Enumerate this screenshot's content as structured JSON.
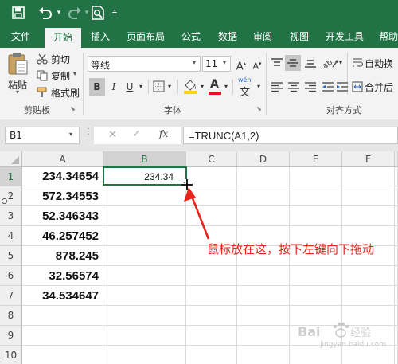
{
  "quick_access": {
    "save_icon": "save-icon",
    "undo_icon": "undo-icon",
    "redo_icon": "redo-icon",
    "print_preview_icon": "print-preview-icon",
    "customize_icon": "customize-icon"
  },
  "tabs": [
    "文件",
    "开始",
    "插入",
    "页面布局",
    "公式",
    "数据",
    "审阅",
    "视图",
    "开发工具",
    "帮助"
  ],
  "active_tab": "开始",
  "ribbon": {
    "clipboard": {
      "paste": "粘贴",
      "cut": "剪切",
      "copy": "复制",
      "format_painter": "格式刷",
      "label": "剪贴板"
    },
    "font": {
      "name": "等线",
      "size": "11",
      "bold": "B",
      "italic": "I",
      "underline": "U",
      "wen_label": "wén",
      "wen_char": "文",
      "label": "字体"
    },
    "alignment": {
      "wrap_text": "自动换",
      "merge": "合并后",
      "label": "对齐方式"
    }
  },
  "formula_bar": {
    "name_box": "B1",
    "cancel": "✕",
    "enter": "✓",
    "fx": "fx",
    "formula": "=TRUNC(A1,2)"
  },
  "sheet": {
    "columns": [
      "A",
      "B",
      "C",
      "D",
      "E",
      "F"
    ],
    "rows": [
      "1",
      "2",
      "3",
      "4",
      "5",
      "6",
      "7",
      "8",
      "9",
      "10"
    ],
    "selected_cell": "B1",
    "column_a": [
      "234.34654",
      "572.34553",
      "52.346343",
      "46.257452",
      "878.245",
      "32.56574",
      "34.534647"
    ],
    "b1": "234.34"
  },
  "annotation": {
    "text": "鼠标放在这，按下左键向下拖动",
    "color": "#e8231a"
  },
  "watermark": {
    "text": "jingyan.baidu.com"
  },
  "colors": {
    "excel_green": "#217346",
    "ribbon_bg": "#f3f3f3",
    "formula_bar_bg": "#e6e6e6"
  }
}
